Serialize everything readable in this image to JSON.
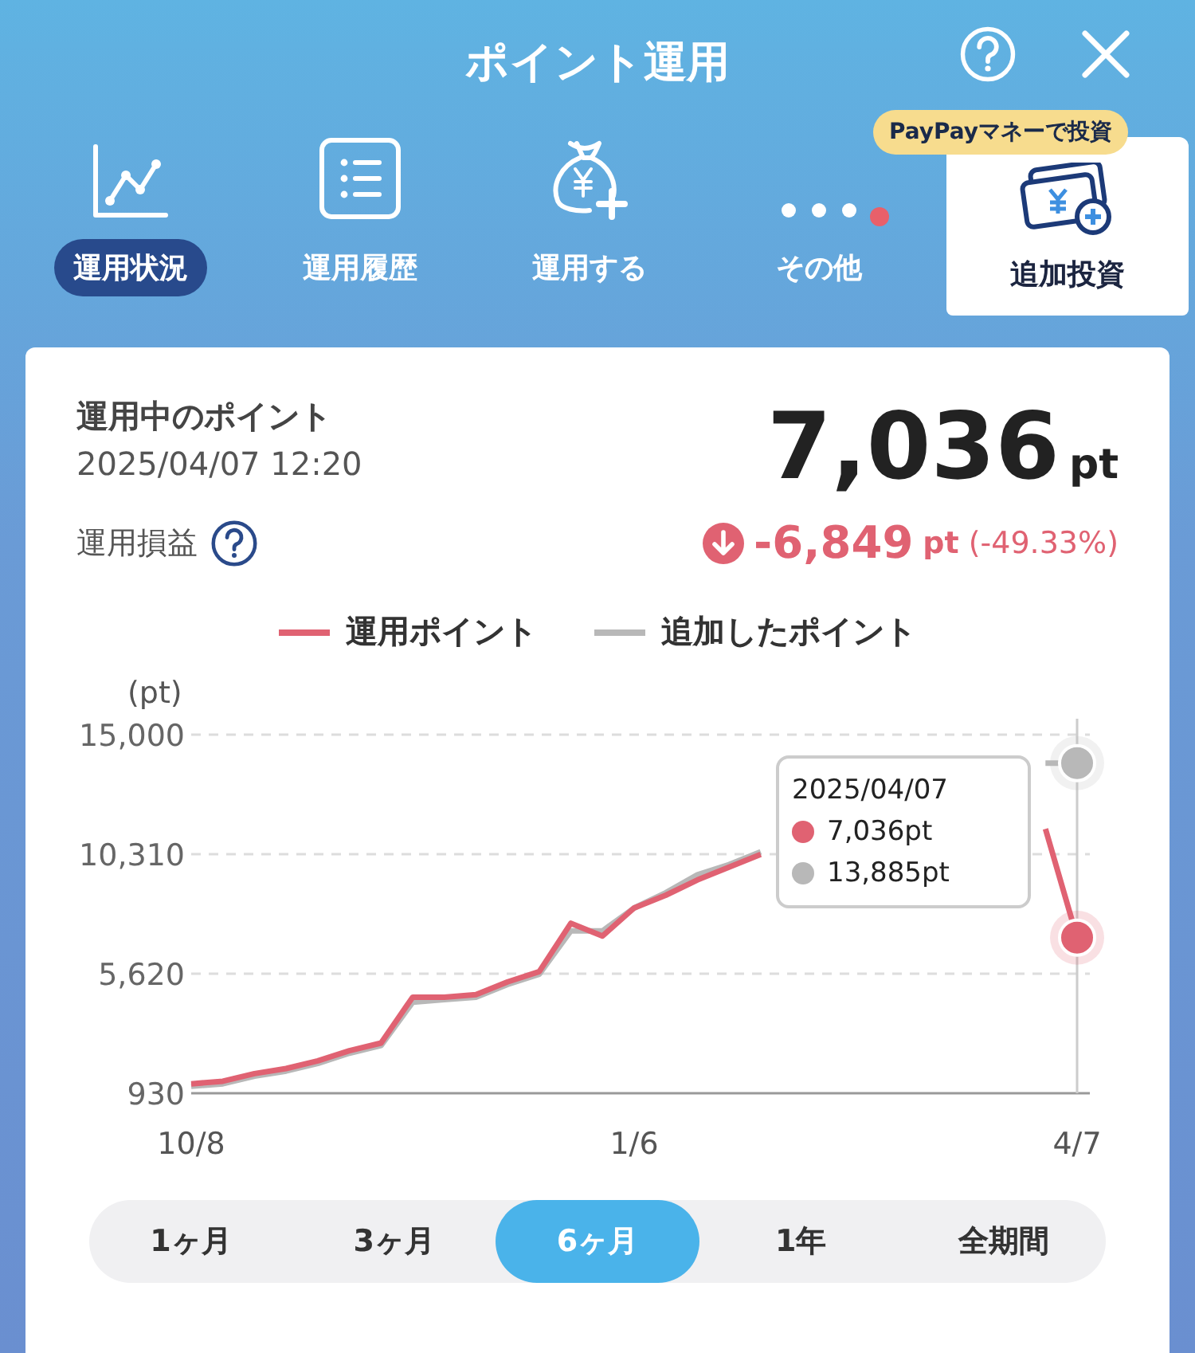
{
  "header": {
    "title": "ポイント運用"
  },
  "nav": [
    {
      "label": "運用状況",
      "selected": true,
      "kind": "chart",
      "notification": false
    },
    {
      "label": "運用履歴",
      "selected": false,
      "kind": "list",
      "notification": false
    },
    {
      "label": "運用する",
      "selected": false,
      "kind": "bag",
      "notification": false
    },
    {
      "label": "その他",
      "selected": false,
      "kind": "more",
      "notification": true
    }
  ],
  "invest": {
    "badge": "PayPayマネーで投資",
    "label": "追加投資"
  },
  "summary": {
    "label": "運用中のポイント",
    "timestamp": "2025/04/07 12:20",
    "value": "7,036",
    "unit": "pt",
    "profit_label": "運用損益",
    "profit": "-6,849",
    "profit_unit": "pt",
    "profit_percent": "(-49.33%)"
  },
  "chart": {
    "y_unit": "(pt)",
    "tooltip": {
      "date": "2025/04/07",
      "items": [
        "7,036pt",
        "13,885pt"
      ]
    },
    "chart_data": {
      "type": "line",
      "categories": [
        "10/8",
        null,
        null,
        null,
        null,
        null,
        null,
        null,
        null,
        null,
        null,
        null,
        null,
        null,
        "1/6",
        null,
        null,
        null,
        null,
        null,
        null,
        null,
        null,
        null,
        null,
        null,
        null,
        null,
        "4/7"
      ],
      "series": [
        {
          "name": "運用ポイント",
          "color": "#e06272",
          "values": [
            1300,
            1400,
            1700,
            1900,
            2200,
            2600,
            2900,
            4700,
            4700,
            4800,
            5300,
            5700,
            7600,
            7100,
            8200,
            8700,
            9300,
            9800,
            10300,
            null,
            null,
            null,
            null,
            null,
            null,
            null,
            null,
            11300,
            7036
          ]
        },
        {
          "name": "追加したポイント",
          "color": "#b8b8b8",
          "values": [
            1200,
            1300,
            1600,
            1800,
            2100,
            2500,
            2800,
            4500,
            4600,
            4700,
            5200,
            5600,
            7300,
            7300,
            8200,
            8800,
            9500,
            9900,
            10400,
            null,
            null,
            null,
            null,
            null,
            null,
            null,
            null,
            13885,
            13885
          ]
        }
      ],
      "ylim": [
        930,
        15000
      ],
      "yticks": [
        {
          "value": 15000,
          "label": "15,000"
        },
        {
          "value": 10310,
          "label": "10,310"
        },
        {
          "value": 5620,
          "label": "5,620"
        },
        {
          "value": 930,
          "label": "930"
        }
      ]
    }
  },
  "periods": [
    {
      "label": "1ヶ月",
      "selected": false
    },
    {
      "label": "3ヶ月",
      "selected": false
    },
    {
      "label": "6ヶ月",
      "selected": true
    },
    {
      "label": "1年",
      "selected": false
    },
    {
      "label": "全期間",
      "selected": false
    }
  ]
}
